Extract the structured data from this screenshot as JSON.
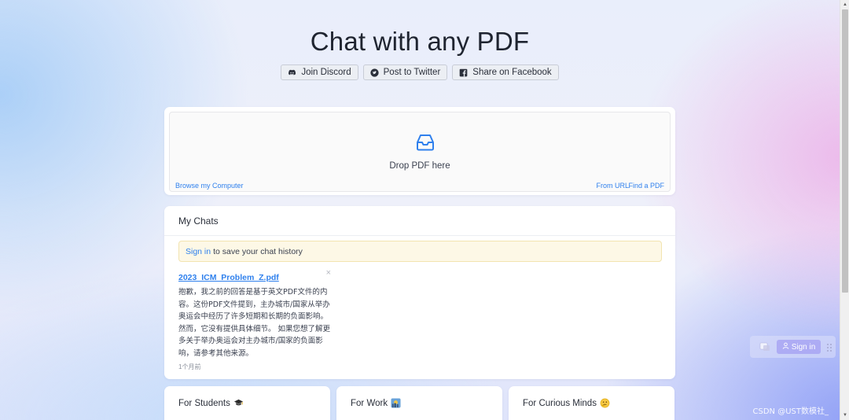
{
  "header": {
    "title": "Chat with any PDF",
    "share_buttons": [
      {
        "label": "Join Discord",
        "icon": "discord-icon"
      },
      {
        "label": "Post to Twitter",
        "icon": "twitter-icon"
      },
      {
        "label": "Share on Facebook",
        "icon": "facebook-icon"
      }
    ]
  },
  "upload": {
    "icon": "inbox-icon",
    "drop_text": "Drop PDF here",
    "browse_label": "Browse my Computer",
    "from_url_label": "From URL",
    "find_pdf_label": "Find a PDF"
  },
  "chats": {
    "header": "My Chats",
    "notice_link": "Sign in",
    "notice_text": "to save your chat history",
    "items": [
      {
        "title": "2023_ICM_Problem_Z.pdf",
        "close": "×",
        "body": "抱歉，我之前的回答是基于英文PDF文件的内容。这份PDF文件提到，主办城市/国家从举办奥运会中经历了许多短期和长期的负面影响。然而，它没有提供具体细节。 如果您想了解更多关于举办奥运会对主办城市/国家的负面影响，请参考其他来源。",
        "time": "1个月前"
      }
    ]
  },
  "categories": [
    {
      "label": "For Students",
      "emoji": "graduation-cap-icon"
    },
    {
      "label": "For Work",
      "emoji": "work-sunrise-icon"
    },
    {
      "label": "For Curious Minds",
      "emoji": "thinking-face-icon"
    }
  ],
  "floating": {
    "signin_label": "Sign in"
  },
  "watermark": "CSDN @UST数模社_",
  "colors": {
    "accent": "#2f80ed",
    "notice_bg": "#fdf8e6"
  }
}
